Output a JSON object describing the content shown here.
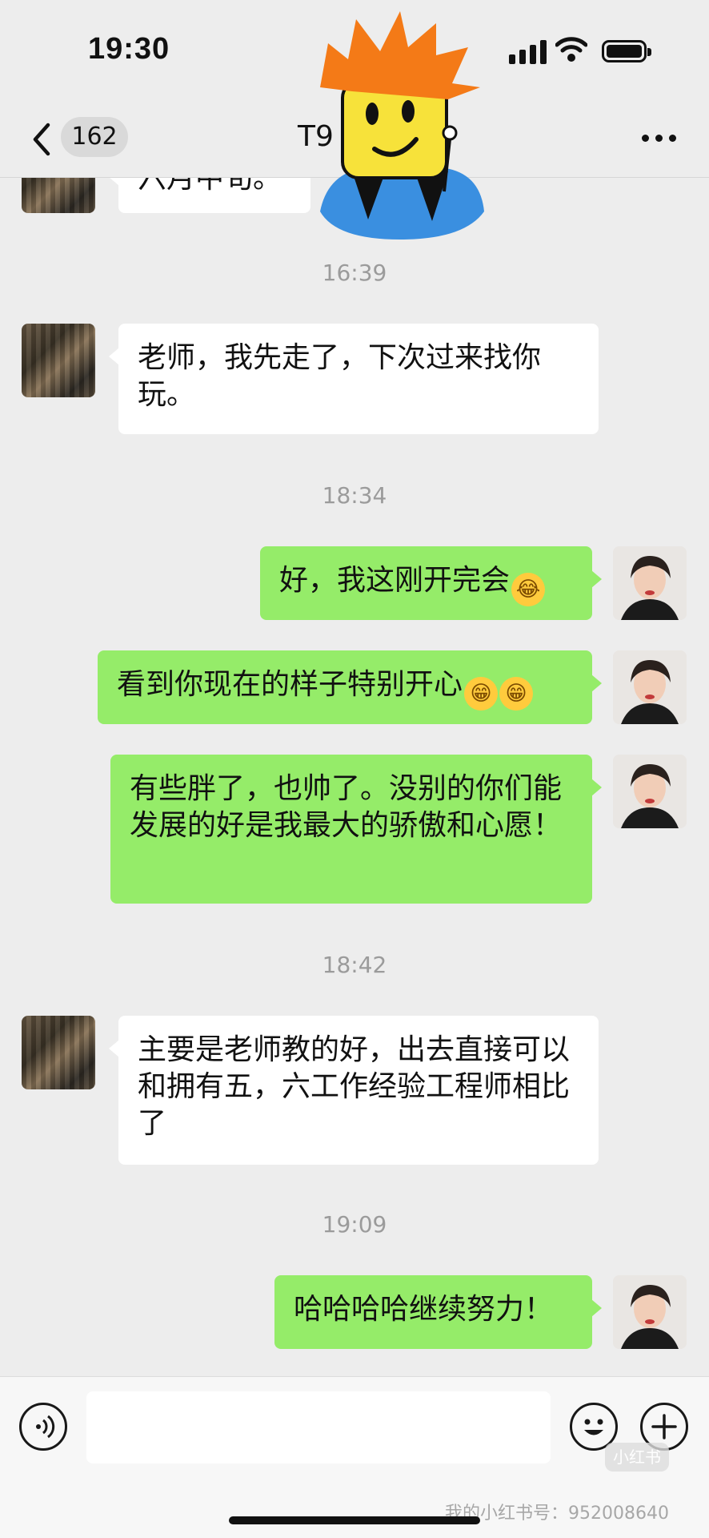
{
  "status_bar": {
    "time": "19:30"
  },
  "header": {
    "unread_count": "162",
    "title": "T9"
  },
  "messages": [
    {
      "side": "in",
      "text": "六月中旬。"
    },
    {
      "type": "time",
      "text": "16:39"
    },
    {
      "side": "in",
      "text": "老师，我先走了，下次过来找你玩。"
    },
    {
      "type": "time",
      "text": "18:34"
    },
    {
      "side": "out",
      "text": "好，我这刚开完会",
      "emoji": [
        "face-with-tears-of-joy"
      ]
    },
    {
      "side": "out",
      "text": "看到你现在的样子特别开心",
      "emoji": [
        "grinning-face",
        "grinning-face"
      ]
    },
    {
      "side": "out",
      "text": "有些胖了，也帅了。没别的你们能发展的好是我最大的骄傲和心愿！"
    },
    {
      "type": "time",
      "text": "18:42"
    },
    {
      "side": "in",
      "text": "主要是老师教的好，出去直接可以和拥有五，六工作经验工程师相比了"
    },
    {
      "type": "time",
      "text": "19:09"
    },
    {
      "side": "out",
      "text": "哈哈哈哈继续努力！"
    }
  ],
  "input": {
    "placeholder": ""
  },
  "watermark": {
    "text": "我的小红书号：952008640",
    "logo": "小红书"
  },
  "colors": {
    "background": "#ededed",
    "bubble_out": "#95ec69",
    "bubble_in": "#ffffff",
    "timestamp": "#9b9b9b"
  },
  "icons": [
    "back-chevron-icon",
    "more-icon",
    "voice-icon",
    "emoji-icon",
    "add-icon"
  ]
}
